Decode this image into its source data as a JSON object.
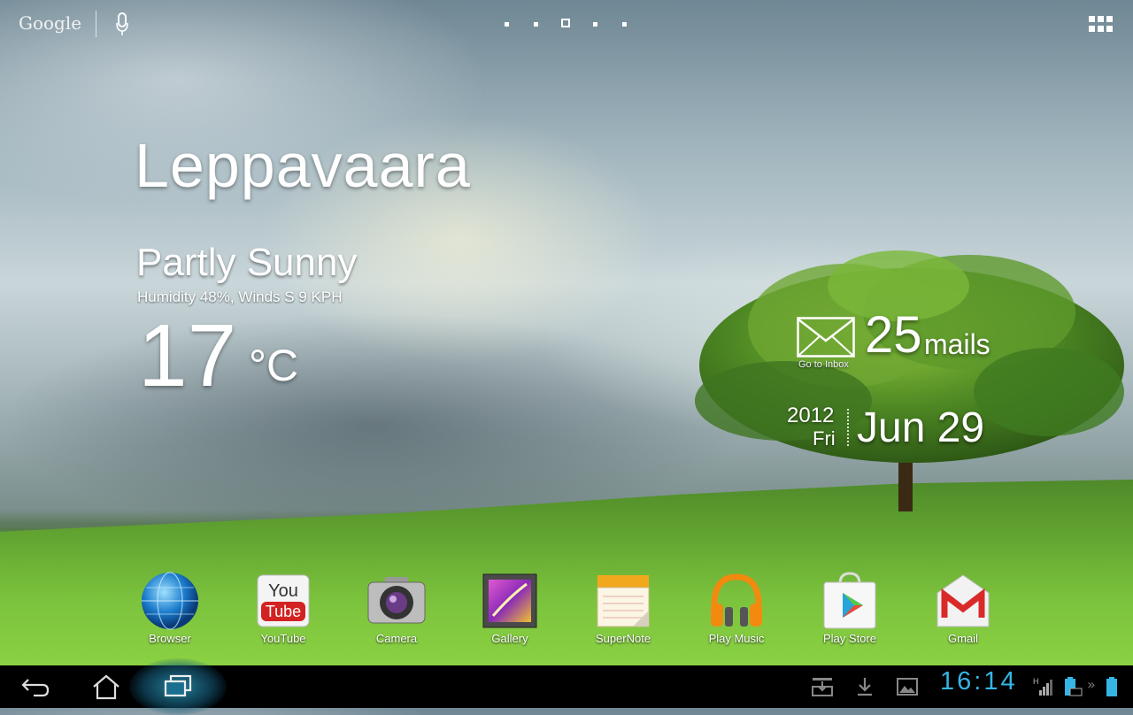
{
  "search": {
    "label": "Google"
  },
  "homescreen": {
    "page_count": 5,
    "active_page": 3
  },
  "weather": {
    "city": "Leppavaara",
    "condition": "Partly Sunny",
    "details": "Humidity 48%, Winds S 9 KPH",
    "temperature": "17",
    "unit": "°C"
  },
  "mail": {
    "count": "25",
    "label": "mails",
    "link": "Go to Inbox"
  },
  "date": {
    "year": "2012",
    "weekday": "Fri",
    "date": "Jun 29"
  },
  "dock": [
    {
      "label": "Browser"
    },
    {
      "label": "YouTube"
    },
    {
      "label": "Camera"
    },
    {
      "label": "Gallery"
    },
    {
      "label": "SuperNote"
    },
    {
      "label": "Play Music"
    },
    {
      "label": "Play Store"
    },
    {
      "label": "Gmail"
    }
  ],
  "youtube_logo": {
    "top": "You",
    "bottom": "Tube"
  },
  "status": {
    "time": "16:14",
    "network": "H"
  },
  "colors": {
    "accent": "#35b5e5",
    "navbar": "#000000"
  }
}
